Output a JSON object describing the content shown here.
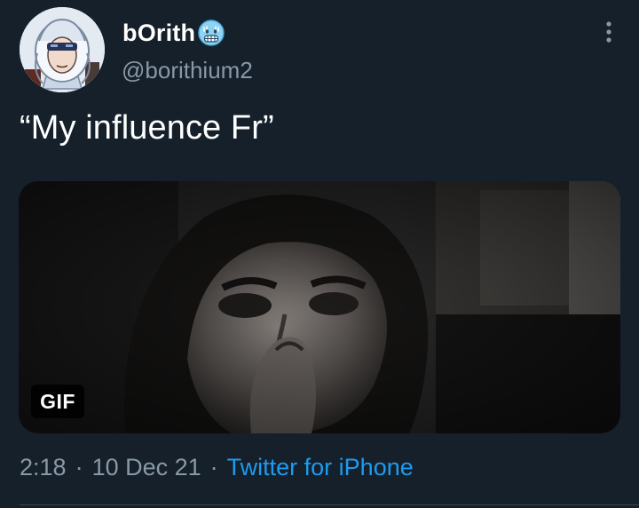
{
  "tweet": {
    "display_name": "bOrith",
    "handle": "@borithium2",
    "text": "“My influence Fr”",
    "media": {
      "type": "gif",
      "badge": "GIF"
    },
    "time": "2:18",
    "separator": "·",
    "date": "10 Dec 21",
    "source": "Twitter for iPhone"
  },
  "icons": {
    "name_emoji": "cold-face-emoji-icon",
    "more": "more-vertical-icon"
  },
  "colors": {
    "background": "#15202b",
    "secondary_text": "#8899a6",
    "link": "#1d9bf0",
    "divider": "#38444d"
  }
}
